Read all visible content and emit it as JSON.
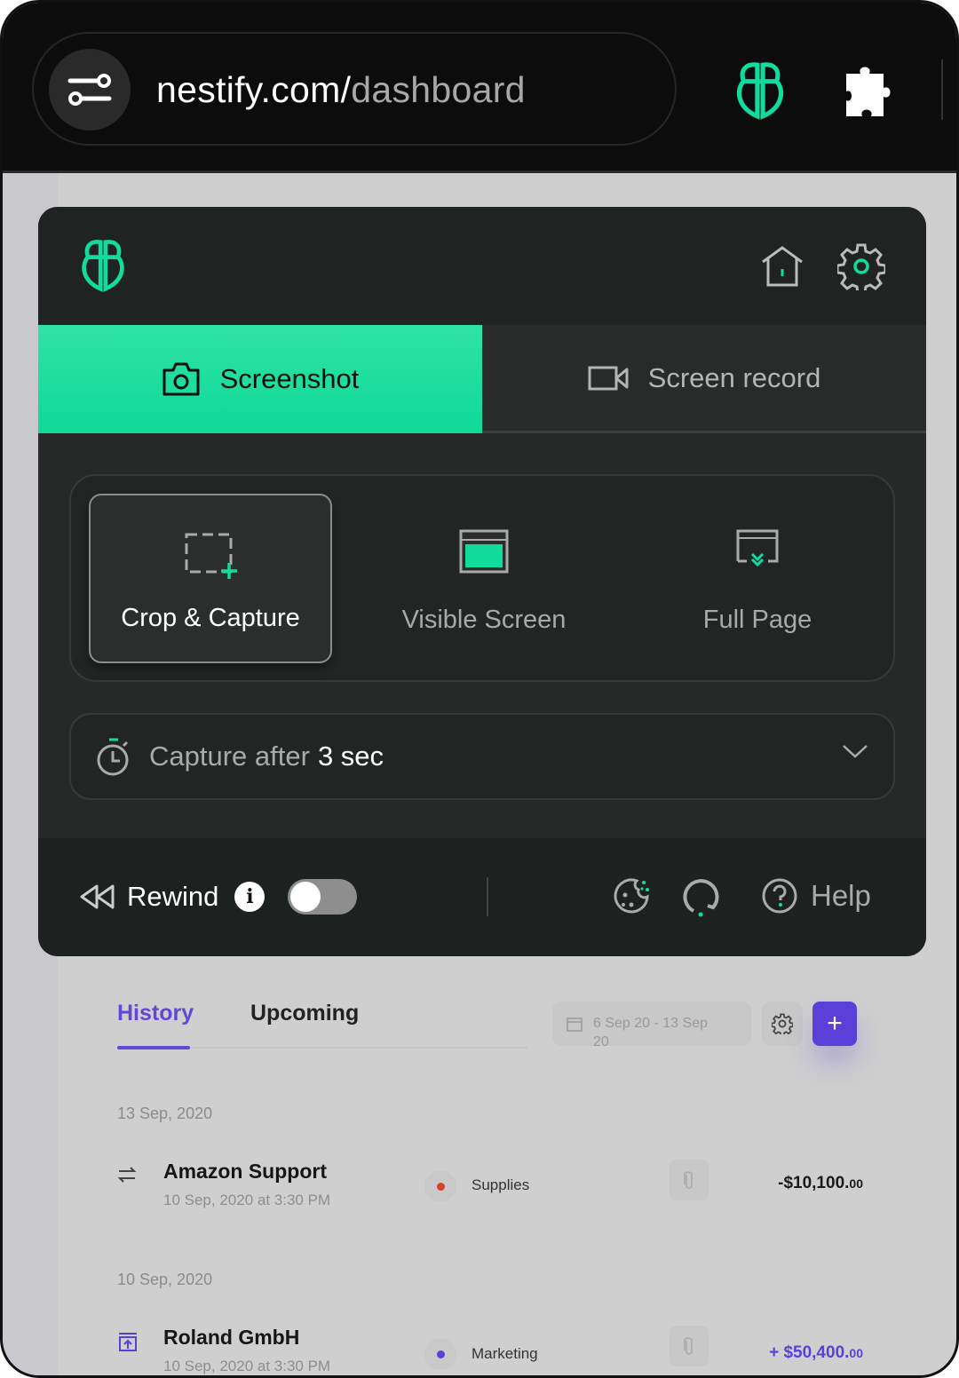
{
  "browser": {
    "url_domain": "nestify.com/",
    "url_path": "dashboard",
    "icons": [
      "sliders-icon",
      "nestify-logo",
      "puzzle-extension-icon"
    ]
  },
  "colors": {
    "accent": "#12dc9c",
    "panel": "#252a29",
    "purple": "#5b3fd9",
    "expense": "#d6412f"
  },
  "panel": {
    "tabs": [
      {
        "label": "Screenshot",
        "icon": "camera-icon",
        "active": true
      },
      {
        "label": "Screen record",
        "icon": "video-icon",
        "active": false
      }
    ],
    "options": [
      {
        "label": "Crop & Capture",
        "icon": "crop-icon",
        "selected": true
      },
      {
        "label": "Visible Screen",
        "icon": "window-icon",
        "selected": false
      },
      {
        "label": "Full Page",
        "icon": "scroll-page-icon",
        "selected": false
      }
    ],
    "delay": {
      "prefix": "Capture after",
      "value": "3 sec"
    },
    "footer": {
      "rewind_label": "Rewind",
      "rewind_on": false,
      "help_label": "Help"
    }
  },
  "page": {
    "tabs": [
      {
        "label": "History",
        "active": true
      },
      {
        "label": "Upcoming",
        "active": false
      }
    ],
    "date_range": {
      "line1": "6 Sep 20 - 13 Sep",
      "line2": "20"
    },
    "add_label": "+",
    "groups": [
      {
        "date": "13 Sep, 2020",
        "items": [
          {
            "name": "Amazon Support",
            "time": "10 Sep, 2020 at 3:30 PM",
            "category": "Supplies",
            "amount": "-$10,100.",
            "cents": "00",
            "type": "expense"
          }
        ]
      },
      {
        "date": "10 Sep, 2020",
        "items": [
          {
            "name": "Roland GmbH",
            "time": "10 Sep, 2020 at 3:30 PM",
            "category": "Marketing",
            "amount": "+ $50,400.",
            "cents": "00",
            "type": "income"
          }
        ]
      }
    ]
  }
}
